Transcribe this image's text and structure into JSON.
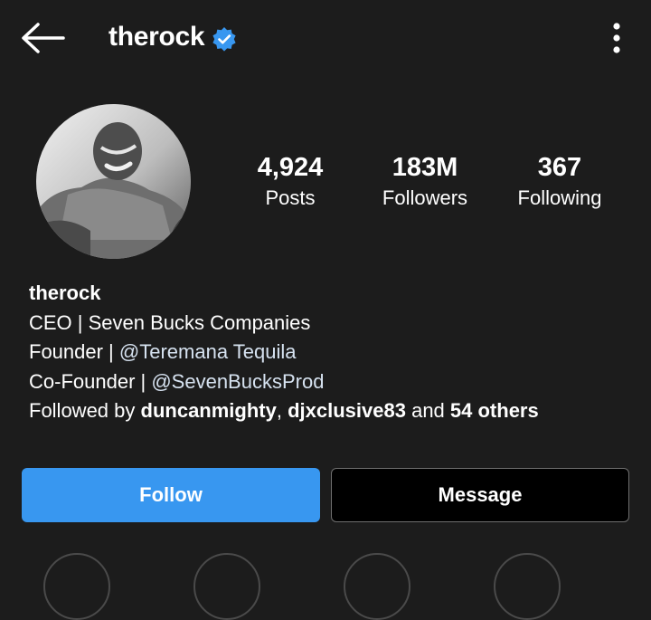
{
  "header": {
    "username": "therock",
    "back_icon": "arrow-left-icon",
    "verified_icon": "verified-badge-icon",
    "more_icon": "more-vertical-icon"
  },
  "profile": {
    "avatar_icon": "profile-photo",
    "stats": {
      "posts": {
        "value": "4,924",
        "label": "Posts"
      },
      "followers": {
        "value": "183M",
        "label": "Followers"
      },
      "following": {
        "value": "367",
        "label": "Following"
      }
    }
  },
  "bio": {
    "name": "therock",
    "line1": "CEO | Seven Bucks Companies",
    "line2_prefix": "Founder | ",
    "line2_mention": "@Teremana Tequila",
    "line3_prefix": "Co-Founder | ",
    "line3_mention": "@SevenBucksProd",
    "followed_by_prefix": "Followed by ",
    "followed_user1": "duncanmighty",
    "followed_sep": ", ",
    "followed_user2": "djxclusive83",
    "followed_and": " and ",
    "followed_others": "54 others"
  },
  "actions": {
    "follow_label": "Follow",
    "message_label": "Message"
  },
  "colors": {
    "background": "#1c1c1c",
    "follow_button": "#3897f0",
    "verified_badge": "#3897f0",
    "message_button": "#000000"
  }
}
